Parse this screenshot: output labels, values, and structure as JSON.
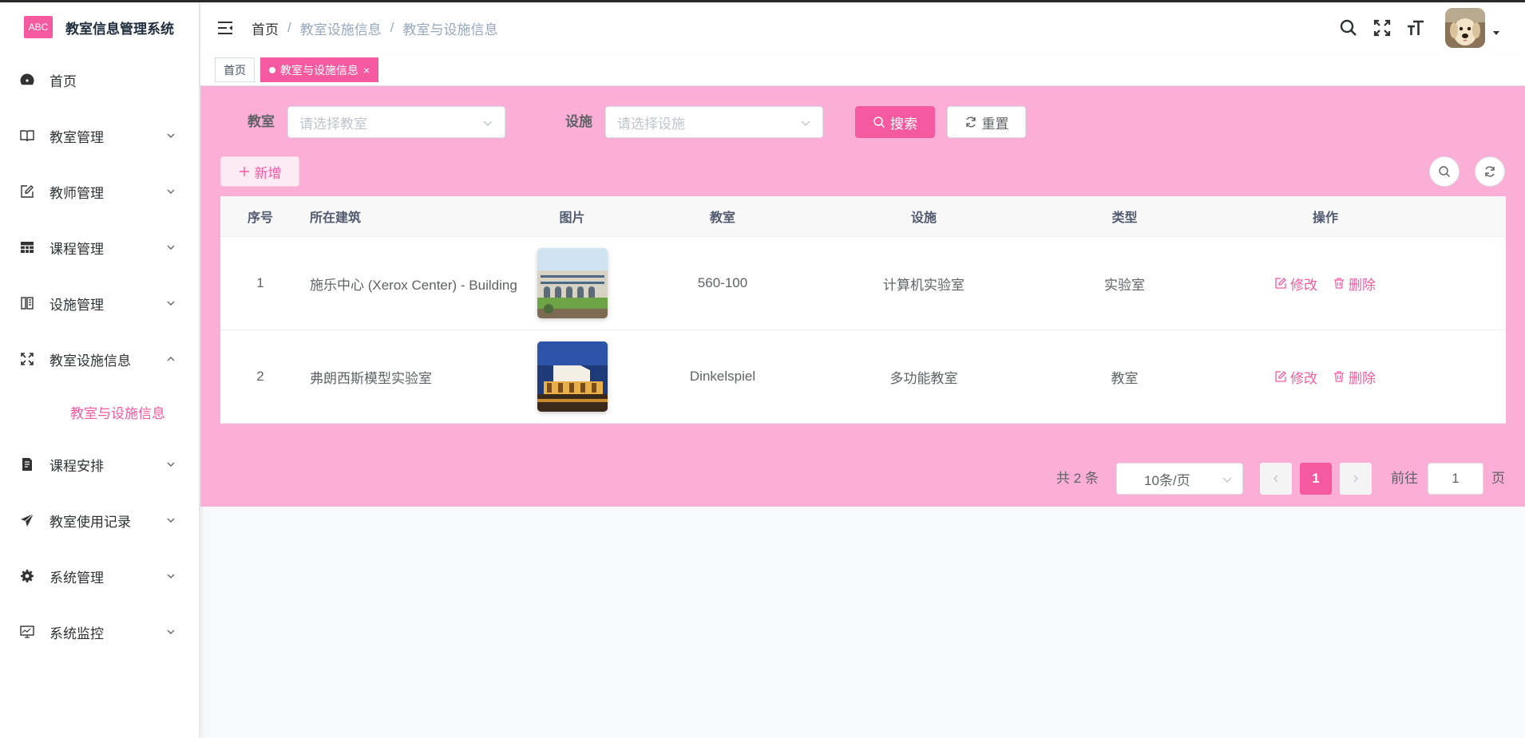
{
  "app": {
    "logo_text": "ABC",
    "title": "教室信息管理系统"
  },
  "sidebar": {
    "items": [
      {
        "label": "首页",
        "icon": "dashboard-icon"
      },
      {
        "label": "教室管理",
        "icon": "book-icon"
      },
      {
        "label": "教师管理",
        "icon": "edit-icon"
      },
      {
        "label": "课程管理",
        "icon": "table-icon"
      },
      {
        "label": "设施管理",
        "icon": "building-icon"
      },
      {
        "label": "教室设施信息",
        "icon": "expand-icon"
      },
      {
        "label": "课程安排",
        "icon": "document-icon"
      },
      {
        "label": "教室使用记录",
        "icon": "send-icon"
      },
      {
        "label": "系统管理",
        "icon": "gear-icon"
      },
      {
        "label": "系统监控",
        "icon": "monitor-icon"
      }
    ],
    "active_sub": "教室与设施信息"
  },
  "breadcrumb": [
    "首页",
    "教室设施信息",
    "教室与设施信息"
  ],
  "tags": {
    "home": "首页",
    "active": "教室与设施信息"
  },
  "search": {
    "classroom_label": "教室",
    "classroom_placeholder": "请选择教室",
    "facility_label": "设施",
    "facility_placeholder": "请选择设施",
    "search_btn": "搜索",
    "reset_btn": "重置"
  },
  "toolbar": {
    "add_btn": "新增"
  },
  "table": {
    "columns": [
      "序号",
      "所在建筑",
      "图片",
      "教室",
      "设施",
      "类型",
      "操作"
    ],
    "rows": [
      {
        "index": "1",
        "building": "施乐中心 (Xerox Center) - Building",
        "classroom": "560-100",
        "facility": "计算机实验室",
        "type": "实验室"
      },
      {
        "index": "2",
        "building": "弗朗西斯模型实验室",
        "classroom": "Dinkelspiel",
        "facility": "多功能教室",
        "type": "教室"
      }
    ],
    "edit_label": "修改",
    "delete_label": "删除"
  },
  "pagination": {
    "total": "共 2 条",
    "page_size": "10条/页",
    "current": "1",
    "goto_label": "前往",
    "goto_value": "1",
    "page_suffix": "页"
  },
  "colors": {
    "accent": "#f55aa0",
    "panel": "#fbaed6"
  }
}
